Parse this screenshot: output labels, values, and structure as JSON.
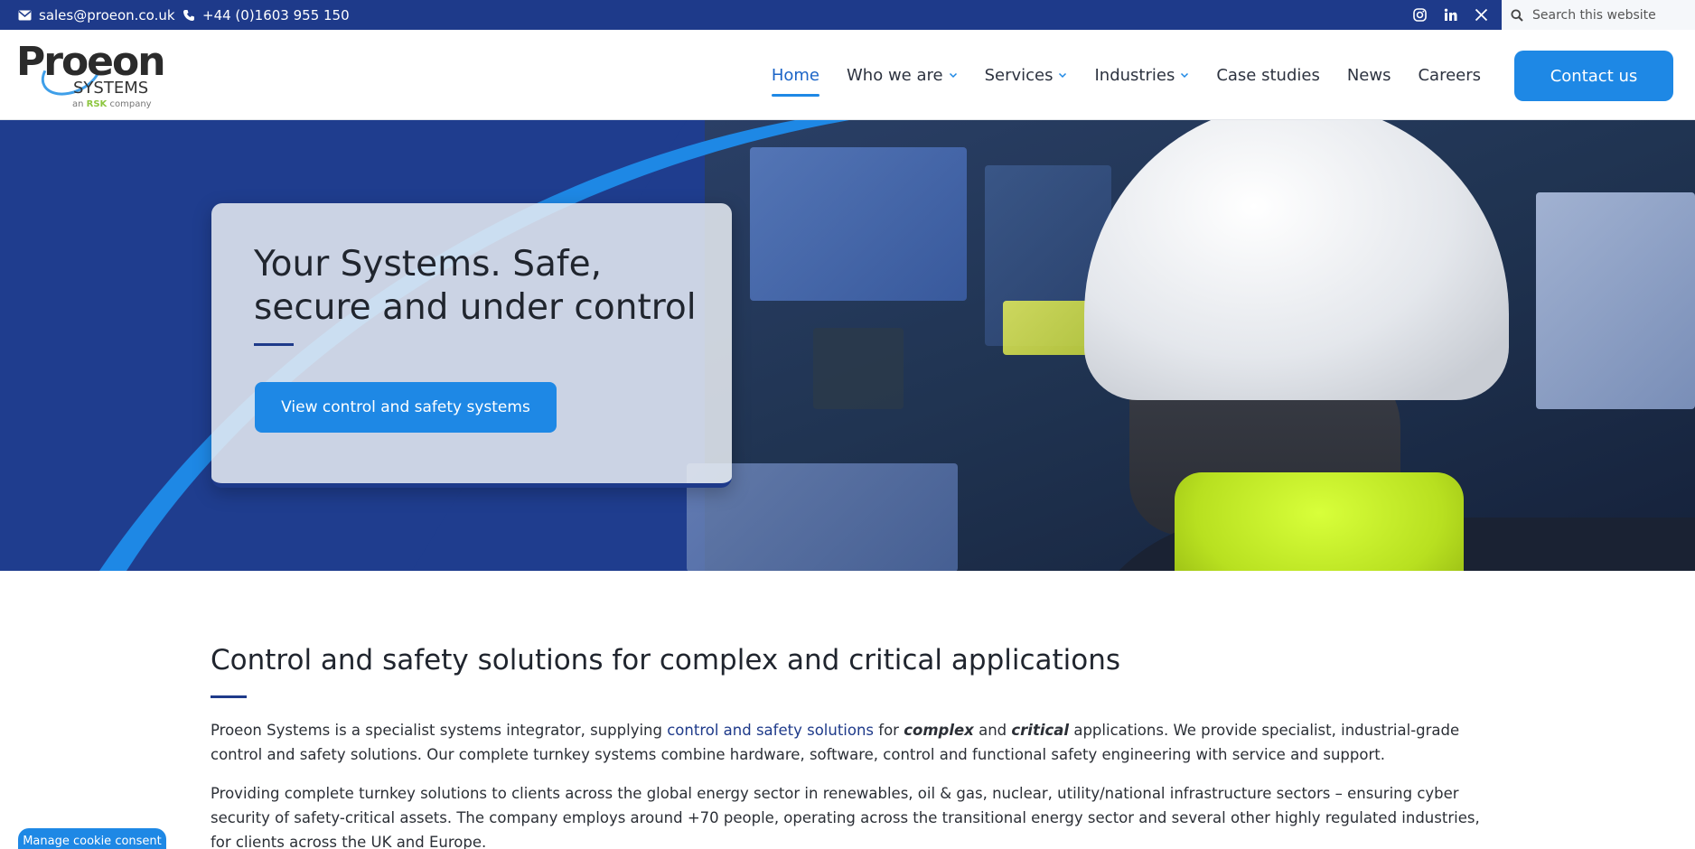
{
  "topbar": {
    "email": "sales@proeon.co.uk",
    "phone": "+44 (0)1603 955 150",
    "social": [
      "instagram-icon",
      "linkedin-icon",
      "x-icon"
    ],
    "search_placeholder": "Search this website"
  },
  "logo": {
    "brand": "Proeon",
    "systems": "SYSTEMS",
    "tagline_prefix": "an ",
    "tagline_brand": "RSK",
    "tagline_suffix": " company"
  },
  "nav": {
    "items": [
      {
        "label": "Home",
        "active": true,
        "dropdown": false
      },
      {
        "label": "Who we are",
        "active": false,
        "dropdown": true
      },
      {
        "label": "Services",
        "active": false,
        "dropdown": true
      },
      {
        "label": "Industries",
        "active": false,
        "dropdown": true
      },
      {
        "label": "Case studies",
        "active": false,
        "dropdown": false
      },
      {
        "label": "News",
        "active": false,
        "dropdown": false
      },
      {
        "label": "Careers",
        "active": false,
        "dropdown": false
      }
    ],
    "contact_label": "Contact us"
  },
  "hero": {
    "title": "Your Systems. Safe, secure and under control",
    "button_label": "View control and safety systems"
  },
  "content": {
    "heading": "Control and safety solutions for complex and critical applications",
    "p1": {
      "before": "Proeon Systems is a specialist systems integrator, supplying ",
      "link": "control and safety solutions",
      "mid1": " for ",
      "em1": "complex",
      "mid2": " and ",
      "em2": "critical",
      "after": " applications.  We provide specialist, industrial-grade control and safety solutions.  Our complete turnkey systems combine hardware, software, control and functional safety engineering with service and support."
    },
    "p2": "Providing complete turnkey solutions to clients across the global energy sector in renewables, oil & gas, nuclear, utility/national infrastructure sectors – ensuring cyber security of safety-critical assets.  The company employs around +70 people, operating across the transitional energy sector and several other highly regulated industries, for clients across the UK and Europe."
  },
  "cookie": {
    "label": "Manage cookie consent"
  },
  "colors": {
    "topbar": "#1e3a8a",
    "accent": "#1e88e5",
    "nav_active": "#1b64c7"
  }
}
